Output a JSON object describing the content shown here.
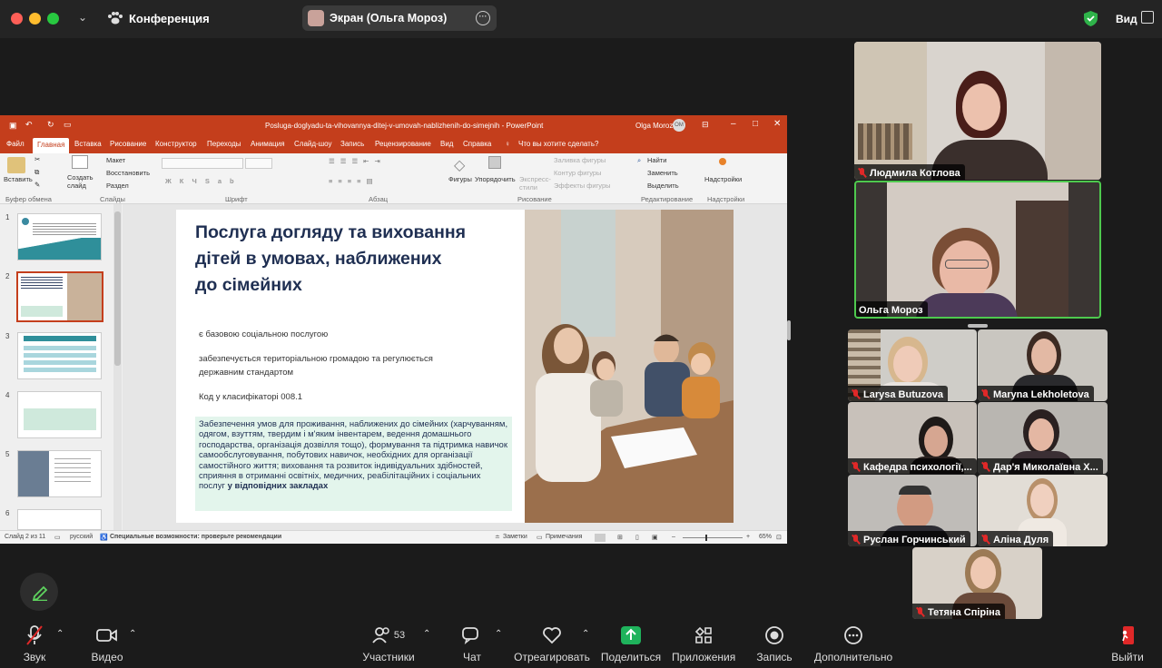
{
  "window": {
    "app_title": "Конференция",
    "view_label": "Вид"
  },
  "share_pill": {
    "label": "Экран (Ольга Мороз)"
  },
  "ppt": {
    "title": "Posluga-doglyadu-ta-vihovannya-ditej-v-umovah-nablizhenih-do-simejnih  -  PowerPoint",
    "user": "Olga Moroz",
    "user_initials": "OM",
    "tabs": [
      "Файл",
      "Главная",
      "Вставка",
      "Рисование",
      "Конструктор",
      "Переходы",
      "Анимация",
      "Слайд-шоу",
      "Запись",
      "Рецензирование",
      "Вид",
      "Справка"
    ],
    "search_hint": "Что вы хотите сделать?",
    "ribbon": {
      "paste": "Вставить",
      "new_slide": "Создать слайд",
      "layout": "Макет",
      "reset": "Восстановить",
      "section": "Раздел",
      "shapes": "Фигуры",
      "arrange": "Упорядочить",
      "quick_styles": "Экспресс-стили",
      "shape_fill": "Заливка фигуры",
      "shape_outline": "Контур фигуры",
      "shape_effects": "Эффекты фигуры",
      "find": "Найти",
      "replace": "Заменить",
      "select": "Выделить",
      "addins": "Надстройки",
      "groups": [
        "Буфер обмена",
        "Слайды",
        "Шрифт",
        "Абзац",
        "Рисование",
        "Редактирование",
        "Надстройки"
      ]
    },
    "thumbnails": [
      {
        "num": "1"
      },
      {
        "num": "2"
      },
      {
        "num": "3"
      },
      {
        "num": "4"
      },
      {
        "num": "5"
      },
      {
        "num": "6"
      }
    ],
    "slide": {
      "title": "Послуга догляду та виховання\nдітей в умовах, наближених\nдо сімейних",
      "line1": "є базовою соціальною послугою",
      "line2": "забезпечується територіальною громадою та регулюється\nдержавним стандартом",
      "line3": "Код у класифікаторі 008.1",
      "box_text": "Забезпечення умов для проживання, наближених до сімейних (харчуванням, одягом, взуттям, твердим і м'яким інвентарем, ведення домашнього господарства, організація дозвілля тощо), формування та підтримка навичок самообслуговування, побутових навичок, необхідних для організації самостійного життя; виховання та розвиток індивідуальних здібностей, сприяння в отриманні освітніх, медичних, реабілітаційних і соціальних послуг ",
      "box_bold": "у відповідних закладах"
    },
    "status": {
      "slide_of": "Слайд 2 из 11",
      "lang": "русский",
      "accessibility": "Специальные возможности: проверьте рекомендации",
      "notes": "Заметки",
      "comments": "Примечания",
      "zoom": "65%"
    }
  },
  "participants": [
    {
      "name": "Людмила Котлова"
    },
    {
      "name": "Ольга Мороз"
    },
    {
      "name": "Larysa Butuzova"
    },
    {
      "name": "Maryna Lekholetova"
    },
    {
      "name": "Кафедра психології,..."
    },
    {
      "name": "Дар'я Миколаївна Х..."
    },
    {
      "name": "Руслан Горчинський"
    },
    {
      "name": "Аліна Дуля"
    },
    {
      "name": "Тетяна Спіріна"
    }
  ],
  "toolbar": {
    "audio": "Звук",
    "video": "Видео",
    "participants": "Участники",
    "participants_count": "53",
    "chat": "Чат",
    "react": "Отреагировать",
    "share": "Поделиться",
    "apps": "Приложения",
    "record": "Запись",
    "more": "Дополнительно",
    "leave": "Выйти"
  },
  "colors": {
    "ppt_accent": "#c43e1c",
    "active_speaker": "#4ec94e",
    "share_green": "#1fb35c",
    "mic_muted": "#e02828",
    "slide_title": "#1f2f52"
  }
}
